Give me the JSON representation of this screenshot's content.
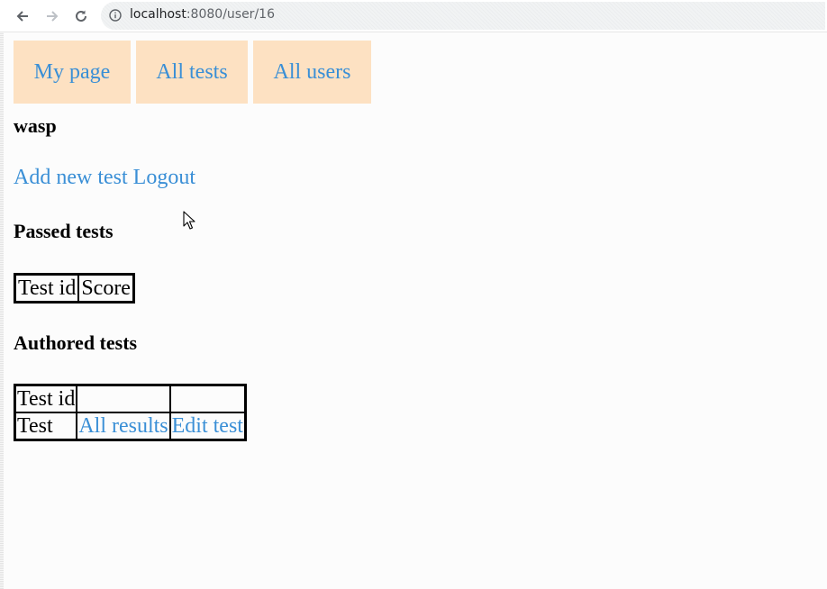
{
  "browser": {
    "url_host": "localhost",
    "url_rest": ":8080/user/16"
  },
  "menu": {
    "items": [
      {
        "label": "My page"
      },
      {
        "label": "All tests"
      },
      {
        "label": "All users"
      }
    ]
  },
  "user": {
    "name": "wasp"
  },
  "actions": {
    "add_label": "Add new test",
    "logout_label": "Logout"
  },
  "passed": {
    "heading": "Passed tests",
    "columns": [
      "Test id",
      "Score"
    ]
  },
  "authored": {
    "heading": "Authored tests",
    "header_row": [
      "Test id",
      "",
      ""
    ],
    "rows": [
      {
        "name": "Test",
        "results_label": "All results",
        "edit_label": "Edit test"
      }
    ]
  },
  "colors": {
    "link": "#3a8fd6",
    "menu_bg": "#fde1c2"
  }
}
